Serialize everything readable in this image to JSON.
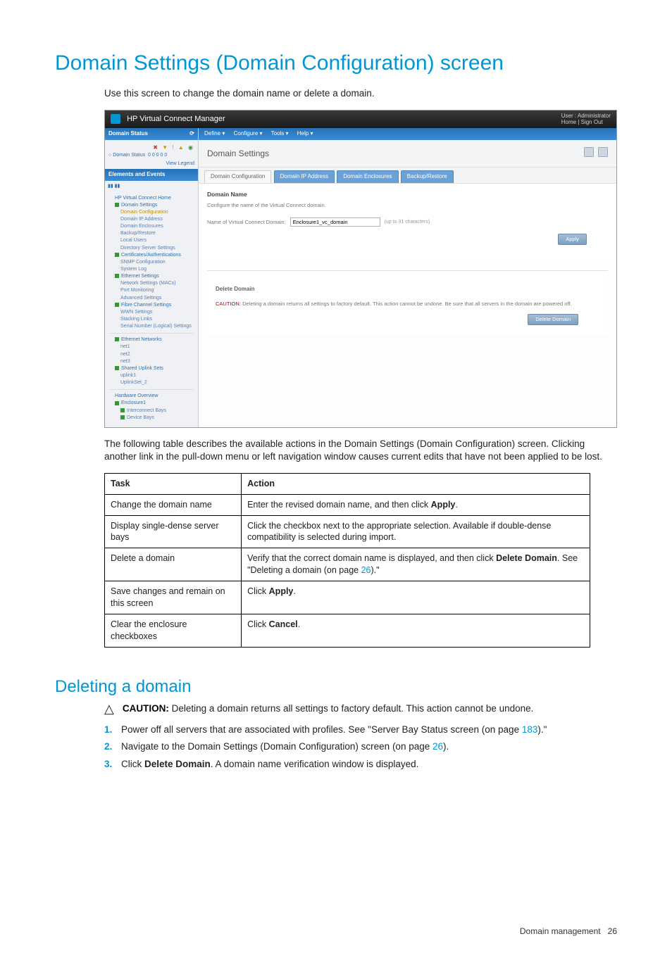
{
  "page": {
    "h1": "Domain Settings (Domain Configuration) screen",
    "intro": "Use this screen to change the domain name or delete a domain.",
    "para_after": "The following table describes the available actions in the Domain Settings (Domain Configuration) screen. Clicking another link in the pull-down menu or left navigation window causes current edits that have not been applied to be lost.",
    "footer_label": "Domain management",
    "footer_page": "26"
  },
  "screenshot": {
    "app_title": "HP Virtual Connect Manager",
    "user_line1": "User : Administrator",
    "user_line2": "Home | Sign Out",
    "sidebar": {
      "status_head": "Domain Status",
      "domain_status_label": "Domain Status",
      "status_counts_label": "0   0   0   0   0",
      "view_legend": "View Legend",
      "sec_head": "Elements and Events",
      "tree": {
        "root": "HP Virtual Connect Home",
        "domain_settings": "Domain Settings",
        "domain_config": "Domain Configuration",
        "domain_ip": "Domain IP Address",
        "domain_enc": "Domain Enclosures",
        "backup": "Backup/Restore",
        "local_users": "Local Users",
        "dir_server": "Directory Server Settings",
        "certs": "Certificates/Authentications",
        "snmp": "SNMP Configuration",
        "syslog": "System Log",
        "eth_settings": "Ethernet Settings",
        "net_macs": "Network Settings (MACs)",
        "port_mon": "Port Monitoring",
        "adv_settings": "Advanced Settings",
        "fc_settings": "Fibre Channel Settings",
        "wwn": "WWN Settings",
        "stacking": "Stacking Links",
        "serial": "Serial Number (Logical) Settings",
        "eth_networks": "Ethernet Networks",
        "net1": "net1",
        "net2": "net2",
        "net3": "net3",
        "shared_uplink": "Shared Uplink Sets",
        "uplink1": "uplink1",
        "uplinkset2": "UplinkSet_2",
        "hw_overview": "Hardware Overview",
        "enclosure1": "Enclosure1",
        "interconnect": "Interconnect Bays",
        "device_bays": "Device Bays"
      }
    },
    "menubar": {
      "define": "Define ▾",
      "configure": "Configure ▾",
      "tools": "Tools ▾",
      "help": "Help ▾"
    },
    "main_title": "Domain Settings",
    "tabs": {
      "t1": "Domain Configuration",
      "t2": "Domain IP Address",
      "t3": "Domain Enclosures",
      "t4": "Backup/Restore"
    },
    "panel1": {
      "heading": "Domain Name",
      "sub": "Configure the name of the Virtual Connect domain.",
      "field_label": "Name of Virtual Connect Domain:",
      "field_value": "Enclosure1_vc_domain",
      "field_hint": "(up to 31 characters)",
      "apply_btn": "Apply"
    },
    "panel2": {
      "heading": "Delete Domain",
      "caution_label": "CAUTION:",
      "caution_text": "Deleting a domain returns all settings to factory default. This action cannot be undone. Be sure that all servers in the domain are powered off.",
      "delete_btn": "Delete Domain"
    }
  },
  "table": {
    "header_task": "Task",
    "header_action": "Action",
    "rows": [
      {
        "task": "Change the domain name",
        "action_pre": "Enter the revised domain name, and then click ",
        "action_bold": "Apply",
        "action_post": "."
      },
      {
        "task": "Display single-dense server bays",
        "action_pre": "Click the checkbox next to the appropriate selection. Available if double-dense compatibility is selected during import.",
        "action_bold": "",
        "action_post": ""
      },
      {
        "task": "Delete a domain",
        "action_pre": "Verify that the correct domain name is displayed, and then click ",
        "action_bold": "Delete Domain",
        "action_post": ". See \"Deleting a domain (on page ",
        "action_link": "26",
        "action_tail": ").\""
      },
      {
        "task": "Save changes and remain on this screen",
        "action_pre": "Click ",
        "action_bold": "Apply",
        "action_post": "."
      },
      {
        "task": "Clear the enclosure checkboxes",
        "action_pre": "Click ",
        "action_bold": "Cancel",
        "action_post": "."
      }
    ]
  },
  "section2": {
    "h2": "Deleting a domain",
    "caution_label": "CAUTION:",
    "caution_text": "Deleting a domain returns all settings to factory default. This action cannot be undone.",
    "step1_pre": "Power off all servers that are associated with profiles. See \"Server Bay Status screen (on page ",
    "step1_link": "183",
    "step1_post": ").\"",
    "step2_pre": "Navigate to the Domain Settings (Domain Configuration) screen (on page ",
    "step2_link": "26",
    "step2_post": ").",
    "step3_pre": "Click ",
    "step3_bold": "Delete Domain",
    "step3_post": ". A domain name verification window is displayed."
  }
}
